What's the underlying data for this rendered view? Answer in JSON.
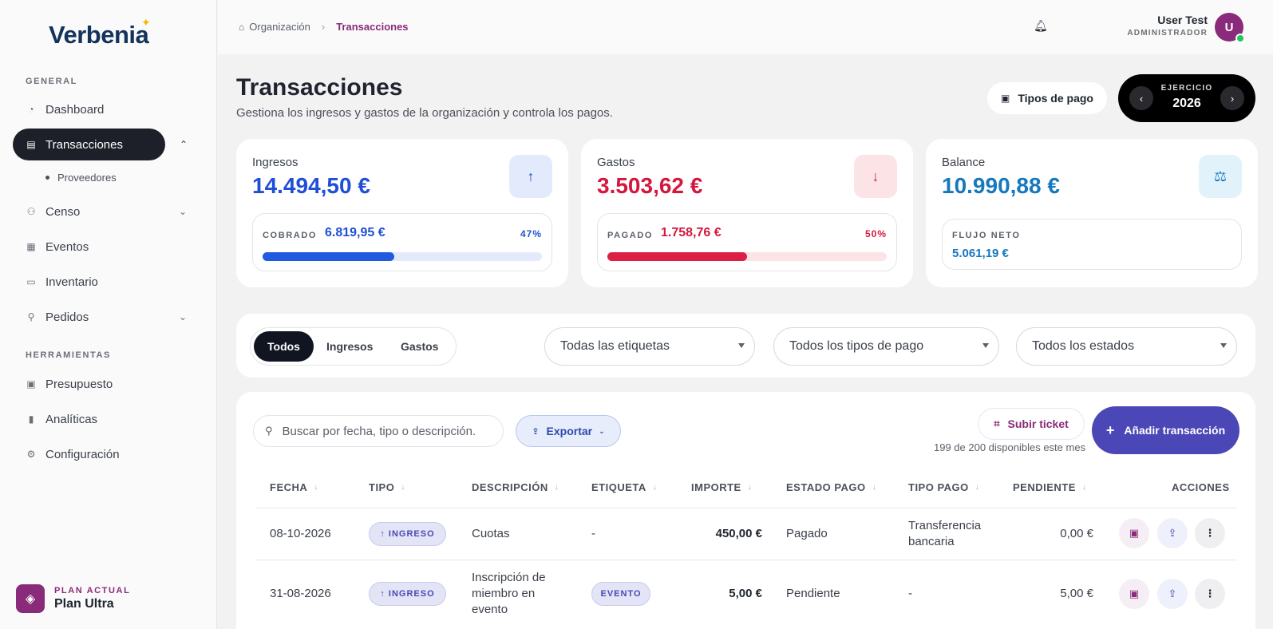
{
  "brand": {
    "logo": "Verbenia"
  },
  "sidebar": {
    "general_label": "GENERAL",
    "tools_label": "HERRAMIENTAS",
    "items": [
      {
        "label": "Dashboard"
      },
      {
        "label": "Transacciones"
      },
      {
        "label": "Censo"
      },
      {
        "label": "Eventos"
      },
      {
        "label": "Inventario"
      },
      {
        "label": "Pedidos"
      }
    ],
    "sub_items": [
      {
        "label": "Proveedores"
      }
    ],
    "tools": [
      {
        "label": "Presupuesto"
      },
      {
        "label": "Analíticas"
      },
      {
        "label": "Configuración"
      }
    ],
    "plan": {
      "label": "PLAN ACTUAL",
      "name": "Plan Ultra"
    }
  },
  "topbar": {
    "breadcrumb": [
      "Organización",
      "Transacciones"
    ],
    "user": {
      "name": "User Test",
      "role": "ADMINISTRADOR",
      "initial": "U"
    }
  },
  "header": {
    "title": "Transacciones",
    "subtitle": "Gestiona los ingresos y gastos de la organización y controla los pagos.",
    "payment_types_button": "Tipos de pago",
    "exercise_label": "EJERCICIO",
    "exercise_year": "2026"
  },
  "stats": {
    "income": {
      "title": "Ingresos",
      "amount": "14.494,50 €",
      "sub_label": "COBRADO",
      "sub_value": "6.819,95 €",
      "percent_text": "47%",
      "progress": 0.47
    },
    "expenses": {
      "title": "Gastos",
      "amount": "3.503,62 €",
      "sub_label": "PAGADO",
      "sub_value": "1.758,76 €",
      "percent_text": "50%",
      "progress": 0.5
    },
    "balance": {
      "title": "Balance",
      "amount": "10.990,88 €",
      "sub_label": "FLUJO NETO",
      "sub_value": "5.061,19 €"
    }
  },
  "filters": {
    "segments": [
      "Todos",
      "Ingresos",
      "Gastos"
    ],
    "active_segment": "Todos",
    "tags_select": "Todas las etiquetas",
    "payment_types_select": "Todos los tipos de pago",
    "status_select": "Todos los estados"
  },
  "toolbar": {
    "search_placeholder": "Buscar por fecha, tipo o descripción.",
    "export_label": "Exportar",
    "upload_ticket_label": "Subir ticket",
    "quota_text": "199 de 200 disponibles este mes",
    "add_label": "Añadir transacción"
  },
  "table": {
    "columns": [
      "FECHA",
      "TIPO",
      "DESCRIPCIÓN",
      "ETIQUETA",
      "IMPORTE",
      "ESTADO PAGO",
      "TIPO PAGO",
      "PENDIENTE",
      "ACCIONES"
    ],
    "rows": [
      {
        "date": "08-10-2026",
        "type": "INGRESO",
        "description": "Cuotas",
        "tag": "-",
        "amount": "450,00 €",
        "status": "Pagado",
        "payment_type": "Transferencia bancaria",
        "pending": "0,00 €"
      },
      {
        "date": "31-08-2026",
        "type": "INGRESO",
        "description": "Inscripción de miembro en evento",
        "tag": "EVENTO",
        "amount": "5,00 €",
        "status": "Pendiente",
        "payment_type": "-",
        "pending": "5,00 €"
      }
    ]
  },
  "colors": {
    "accent": "#8a2a7a",
    "income": "#1f4fd6",
    "expense": "#d4183d",
    "balance": "#1678bd",
    "primary_button": "#4b47b6"
  }
}
